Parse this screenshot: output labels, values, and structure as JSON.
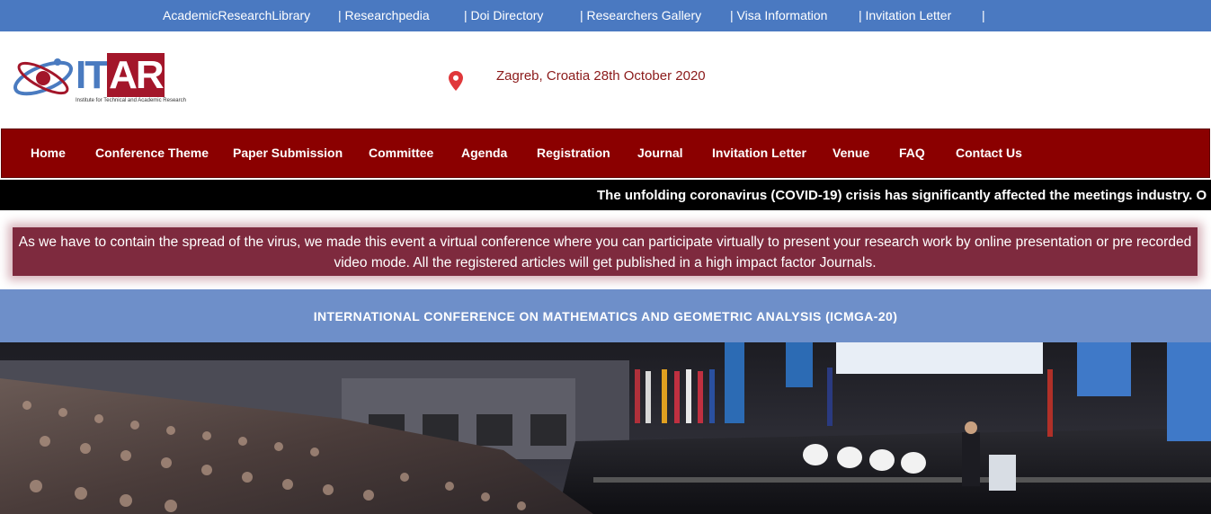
{
  "top_links": [
    "AcademicResearchLibrary",
    "| Researchpedia",
    "| Doi Directory",
    "| Researchers Gallery",
    "| Visa Information",
    "| Invitation Letter",
    "|"
  ],
  "logo": {
    "text_left": "IT",
    "text_right": "AR",
    "tagline": "Institute for Technical and Academic Research"
  },
  "event_info": "Zagreb, Croatia 28th October 2020",
  "nav_items": [
    "Home",
    "Conference Theme",
    "Paper Submission",
    "Committee",
    "Agenda",
    "Registration",
    "Journal",
    "Invitation Letter",
    "Venue",
    "FAQ",
    "Contact Us"
  ],
  "ticker": "The unfolding coronavirus (COVID-19) crisis has significantly affected the meetings industry. O",
  "notice": "As we have to contain the spread of the virus, we made this event a virtual conference where you can participate virtually to present your research work by online presentation or pre recorded video mode. All the registered articles will get published in a high impact factor Journals.",
  "conference_title": "INTERNATIONAL CONFERENCE ON MATHEMATICS AND GEOMETRIC ANALYSIS (ICMGA-20)",
  "colors": {
    "topbar": "#4a79c1",
    "nav": "#8b0000",
    "ticker": "#000000",
    "notice": "#7e2a3e",
    "band": "#6e8fc9",
    "logo_blue": "#4a7bc0",
    "logo_red": "#a3162a"
  },
  "icons": {
    "location": "map-pin-icon"
  }
}
